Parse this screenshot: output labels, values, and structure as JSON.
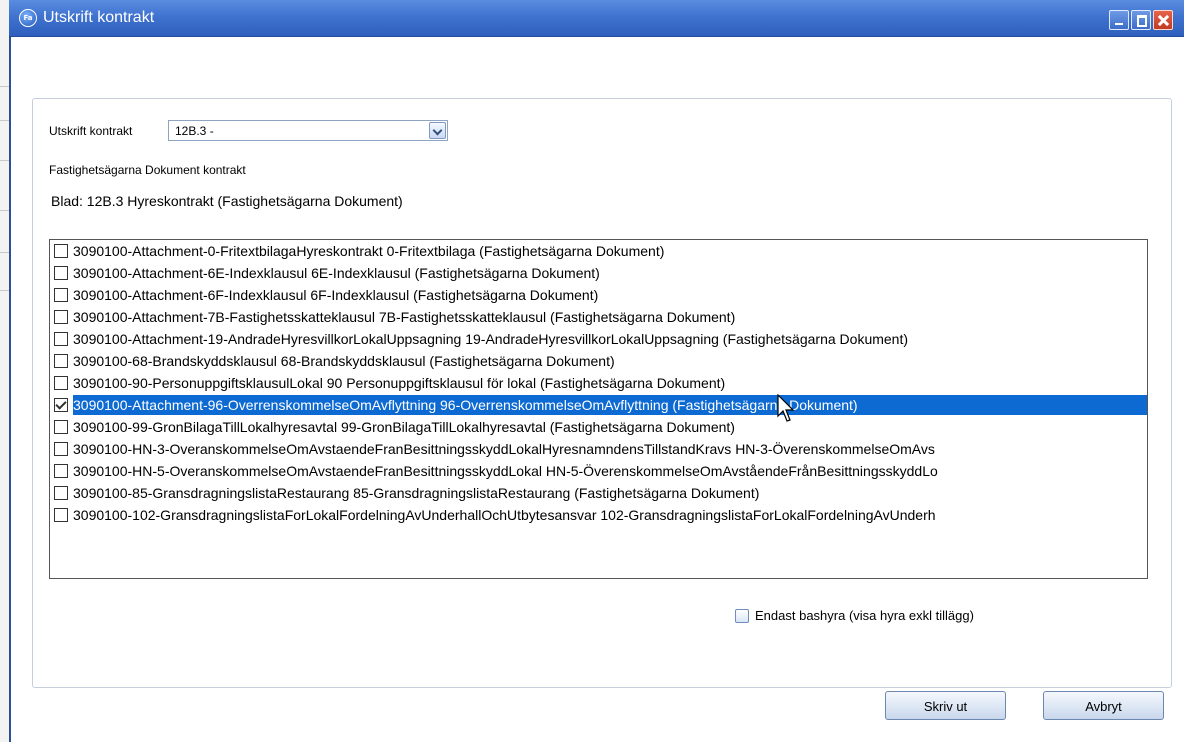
{
  "window": {
    "title": "Utskrift kontrakt",
    "icon_text": "Fa"
  },
  "form": {
    "contract_label": "Utskrift kontrakt",
    "contract_value": "12B.3 -",
    "section_label": "Fastighetsägarna Dokument kontrakt",
    "sheet_label": "Blad: 12B.3 Hyreskontrakt (Fastighetsägarna Dokument)"
  },
  "documents": [
    {
      "text": "3090100-Attachment-0-FritextbilagaHyreskontrakt 0-Fritextbilaga (Fastighetsägarna Dokument)",
      "checked": false,
      "selected": false
    },
    {
      "text": "3090100-Attachment-6E-Indexklausul 6E-Indexklausul (Fastighetsägarna Dokument)",
      "checked": false,
      "selected": false
    },
    {
      "text": "3090100-Attachment-6F-Indexklausul 6F-Indexklausul (Fastighetsägarna Dokument)",
      "checked": false,
      "selected": false
    },
    {
      "text": "3090100-Attachment-7B-Fastighetsskatteklausul 7B-Fastighetsskatteklausul (Fastighetsägarna Dokument)",
      "checked": false,
      "selected": false
    },
    {
      "text": "3090100-Attachment-19-AndradeHyresvillkorLokalUppsagning 19-AndradeHyresvillkorLokalUppsagning (Fastighetsägarna Dokument)",
      "checked": false,
      "selected": false
    },
    {
      "text": "3090100-68-Brandskyddsklausul 68-Brandskyddsklausul (Fastighetsägarna Dokument)",
      "checked": false,
      "selected": false
    },
    {
      "text": "3090100-90-PersonuppgiftsklausulLokal 90 Personuppgiftsklausul för lokal (Fastighetsägarna Dokument)",
      "checked": false,
      "selected": false
    },
    {
      "text": "3090100-Attachment-96-OverrenskommelseOmAvflyttning 96-OverrenskommelseOmAvflyttning (Fastighetsägarna Dokument)",
      "checked": true,
      "selected": true
    },
    {
      "text": "3090100-99-GronBilagaTillLokalhyresavtal 99-GronBilagaTillLokalhyresavtal (Fastighetsägarna Dokument)",
      "checked": false,
      "selected": false
    },
    {
      "text": "3090100-HN-3-OveranskommelseOmAvstaendeFranBesittningsskyddLokalHyresnamndensTillstandKravs HN-3-ÖverenskommelseOmAvs",
      "checked": false,
      "selected": false
    },
    {
      "text": "3090100-HN-5-OveranskommelseOmAvstaendeFranBesittningsskyddLokal HN-5-ÖverenskommelseOmAvståendeFrånBesittningsskyddLo",
      "checked": false,
      "selected": false
    },
    {
      "text": "3090100-85-GransdragningslistaRestaurang 85-GransdragningslistaRestaurang (Fastighetsägarna Dokument)",
      "checked": false,
      "selected": false
    },
    {
      "text": "3090100-102-GransdragningslistaForLokalFordelningAvUnderhallOchUtbytesansvar 102-GransdragningslistaForLokalFordelningAvUnderh",
      "checked": false,
      "selected": false
    }
  ],
  "options": {
    "base_rent_label": "Endast bashyra (visa hyra exkl tillägg)",
    "base_rent_checked": false
  },
  "buttons": {
    "print": "Skriv ut",
    "cancel": "Avbryt"
  }
}
